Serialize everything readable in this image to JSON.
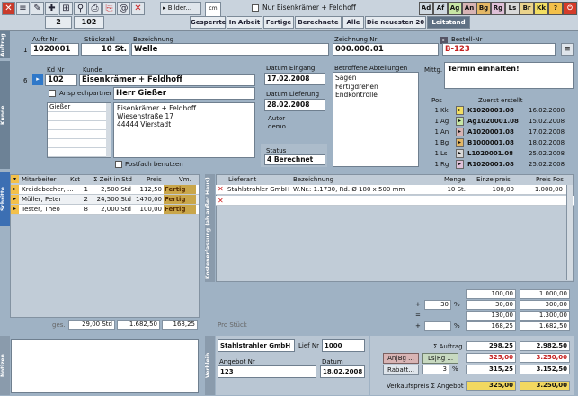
{
  "toolbar": {
    "count": "2",
    "number": "102",
    "bilder_label": "▸ Bilder...",
    "cm_label": "cm",
    "cm_value": "1",
    "filter_checkbox_label": "Nur Eisenkrämer + Feldhoff",
    "departments": [
      {
        "code": "Ad",
        "color": "#cfd8e0"
      },
      {
        "code": "Af",
        "color": "#cfd8e0"
      },
      {
        "code": "Ag",
        "color": "#c7e6a4"
      },
      {
        "code": "An",
        "color": "#d8b4b4"
      },
      {
        "code": "Bg",
        "color": "#e3b766"
      },
      {
        "code": "Rg",
        "color": "#dfc0d8"
      },
      {
        "code": "Ls",
        "color": "#d8d8d8"
      },
      {
        "code": "Br",
        "color": "#ead38c"
      },
      {
        "code": "Kk",
        "color": "#f2de62"
      }
    ],
    "help": "?",
    "power": "⏻"
  },
  "tabs": [
    "Gesperrte",
    "In Arbeit",
    "Fertige",
    "Berechnete",
    "Alle",
    "Die neuesten 20",
    "Leitstand"
  ],
  "order": {
    "section_label": "Auftrag",
    "row_index": "1",
    "auftr_nr_label": "Auftr Nr",
    "auftr_nr": "1020001",
    "stueckzahl_label": "Stückzahl",
    "stueckzahl": "10 St.",
    "bezeichnung_label": "Bezeichnung",
    "bezeichnung": "Welle",
    "zeichnung_nr_label": "Zeichnung Nr",
    "zeichnung_nr": "000.000.01",
    "bestell_nr_label": "Bestell-Nr",
    "bestell_nr": "B-123"
  },
  "customer": {
    "section_label": "Kunde",
    "row_index": "6",
    "kd_nr_label": "Kd Nr",
    "kd_nr": "102",
    "kunde_label": "Kunde",
    "kunde": "Eisenkrämer + Feldhoff",
    "ansprechpartner_label": "Ansprechpartner",
    "ansprechpartner": "Herr Gießer",
    "contacts": [
      "Gießer",
      "",
      "",
      "",
      "",
      ""
    ],
    "address": [
      "Eisenkrämer + Feldhoff",
      "Wiesenstraße 17",
      "44444 Vierstadt"
    ],
    "postfach_label": "Postfach benutzen"
  },
  "dates": {
    "eingang_label": "Datum Eingang",
    "eingang": "17.02.2008",
    "lieferung_label": "Datum Lieferung",
    "lieferung": "28.02.2008",
    "autor_label": "Autor",
    "autor": "demo",
    "status_label": "Status",
    "status": "4 Berechnet"
  },
  "departments_box": {
    "label": "Betroffene Abteilungen",
    "items": [
      "Sägen",
      "Fertigdrehen",
      "Endkontrolle"
    ]
  },
  "notice": {
    "label": "Mittg.",
    "text": "Termin einhalten!"
  },
  "positions": {
    "pos_label": "Pos",
    "created_label": "Zuerst erstellt",
    "rows": [
      {
        "pos": "1",
        "code": "Kk",
        "nr": "K1020001.08",
        "date": "16.02.2008"
      },
      {
        "pos": "1",
        "code": "Ag",
        "nr": "Ag1020001.08",
        "date": "15.02.2008"
      },
      {
        "pos": "1",
        "code": "An",
        "nr": "A1020001.08",
        "date": "17.02.2008"
      },
      {
        "pos": "1",
        "code": "Bg",
        "nr": "B1000001.08",
        "date": "18.02.2008"
      },
      {
        "pos": "1",
        "code": "Ls",
        "nr": "L1020001.08",
        "date": "25.02.2008"
      },
      {
        "pos": "1",
        "code": "Rg",
        "nr": "R1020001.08",
        "date": "25.02.2008"
      }
    ]
  },
  "workers": {
    "section_label": "Schritte",
    "headers": {
      "mitarbeiter": "Mitarbeiter",
      "kst": "Kst",
      "zeit": "Σ Zeit in Std",
      "preis": "Preis",
      "vm": "Vm."
    },
    "rows": [
      {
        "name": "Kreidebecher, ...",
        "kst": "1",
        "zeit": "2,500 Std",
        "preis": "112,50",
        "vm": "Fertig"
      },
      {
        "name": "Müller, Peter",
        "kst": "2",
        "zeit": "24,500 Std",
        "preis": "1470,00",
        "vm": "Fertig"
      },
      {
        "name": "Tester, Theo",
        "kst": "8",
        "zeit": "2,000 Std",
        "preis": "100,00",
        "vm": "Fertig"
      }
    ],
    "footer_label": "ges.",
    "total_zeit": "29,00 Std",
    "total_preis": "1.682,50",
    "total_vm": "168,25"
  },
  "materials": {
    "section_label": "Kostenerfassung (ab außer Haus)",
    "headers": {
      "lieferant": "Lieferant",
      "bezeichnung": "Bezeichnung",
      "menge": "Menge",
      "einzelpreis": "Einzelpreis",
      "preis_pos": "Preis Pos"
    },
    "rows": [
      {
        "lieferant": "Stahlstrahler GmbH",
        "bezeichnung": "W.Nr.: 1.1730, Rd. Ø 180 x 500 mm",
        "menge": "10 St.",
        "einzelpreis": "100,00",
        "preis_pos": "1.000,00"
      }
    ],
    "pro_stueck_label": "Pro Stück",
    "calc": [
      {
        "sign": "",
        "pct": "",
        "left": "100,00",
        "right": "1.000,00"
      },
      {
        "sign": "+",
        "pct": "30",
        "left": "30,00",
        "right": "300,00"
      },
      {
        "sign": "=",
        "pct": "",
        "left": "130,00",
        "right": "1.300,00"
      },
      {
        "sign": "+",
        "pct": "",
        "left": "168,25",
        "right": "1.682,50"
      }
    ]
  },
  "notes": {
    "section_label": "Notizen"
  },
  "supplier": {
    "section_label": "Verbleib",
    "name": "Stahlstrahler GmbH",
    "lief_nr_label": "Lief Nr",
    "lief_nr": "1000",
    "angebot_nr_label": "Angebot Nr",
    "angebot_nr": "123",
    "datum_label": "Datum",
    "datum": "18.02.2008"
  },
  "totals": {
    "auftrag_label": "Σ Auftrag",
    "auftrag_left": "298,25",
    "auftrag_right": "2.982,50",
    "btn1": "An|Bg ...",
    "btn2": "Ls|Rg ...",
    "row2_left": "325,00",
    "row2_right": "3.250,00",
    "rabatt_label": "Rabatt...",
    "rabatt_pct": "3",
    "rabatt_left": "315,25",
    "rabatt_right": "3.152,50",
    "verkauf_label": "Verkaufspreis Σ Angebot",
    "verkauf_left": "325,00",
    "verkauf_right": "3.250,00"
  }
}
